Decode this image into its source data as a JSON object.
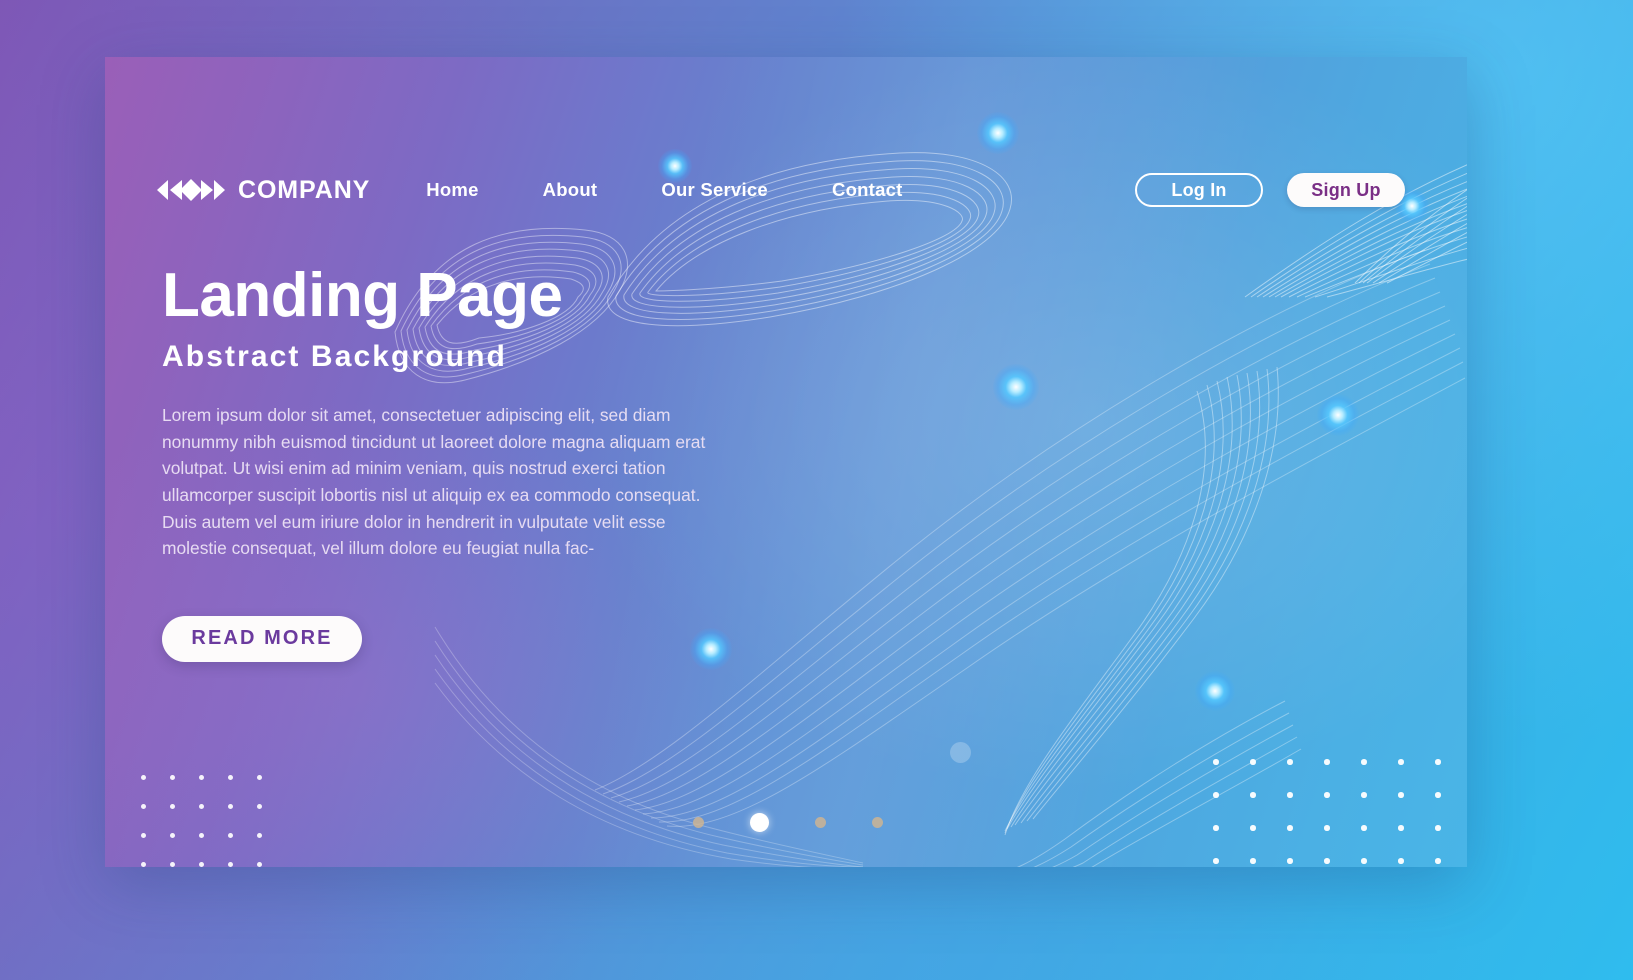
{
  "brand": {
    "name": "COMPANY",
    "logo_icon": "chevron-diamond-logo-icon"
  },
  "nav": {
    "links": [
      {
        "label": "Home"
      },
      {
        "label": "About"
      },
      {
        "label": "Our Service"
      },
      {
        "label": "Contact"
      }
    ],
    "login_label": "Log In",
    "signup_label": "Sign Up"
  },
  "hero": {
    "title": "Landing Page",
    "subtitle": "Abstract Background",
    "paragraph": "Lorem ipsum dolor sit amet, consectetuer adipiscing elit, sed diam nonummy nibh euismod tincidunt ut laoreet dolore magna aliquam erat volutpat. Ut wisi enim ad minim veniam, quis nostrud exerci tation ullamcorper suscipit lobortis nisl ut aliquip ex ea commodo consequat. Duis autem vel eum iriure dolor in hendrerit in vulputate velit esse molestie consequat, vel illum dolore eu feugiat nulla fac-",
    "cta_label": "READ MORE"
  },
  "carousel": {
    "dots": [
      {
        "active": false
      },
      {
        "active": true
      },
      {
        "active": false
      },
      {
        "active": false
      }
    ]
  },
  "colors": {
    "gradient_start": "#9a5fb8",
    "gradient_mid": "#6484cf",
    "gradient_end": "#49b5e7",
    "accent_purple": "#6b3a9e",
    "signup_text": "#7a2f86",
    "text_light": "#ffffff",
    "paragraph_text": "#eadff4",
    "dot_inactive": "#cdb493",
    "glow_cyan": "#55c8ff"
  }
}
